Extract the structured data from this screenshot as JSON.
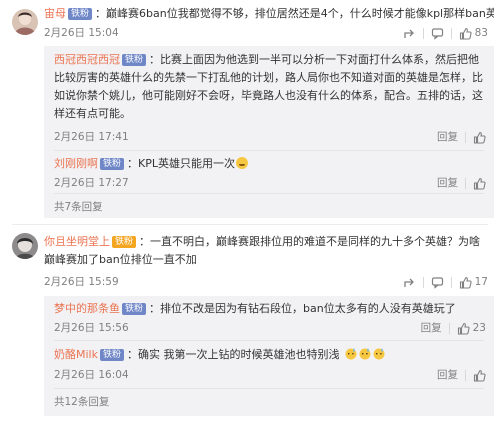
{
  "comments": [
    {
      "user": "宙母",
      "badge": "铁粉",
      "text": "巅峰赛6ban位我都觉得不够，排位居然还是4个，什么时候才能像kpl那样ban英雄",
      "time": "2月26日 15:04",
      "reply_label": "回复",
      "likes": "83",
      "replies": [
        {
          "user": "西冠西冠西冠",
          "badge": "铁粉",
          "text": "比赛上面因为他选到一半可以分析一下对面打什么体系，然后把他比较厉害的英雄什么的先禁一下打乱他的计划，路人局你也不知道对面的英雄是怎样，比如说你禁个姚儿，他可能刚好不会呀，毕竟路人也没有什么的体系，配合。五排的话，这样还有点可能。",
          "time": "2月26日 17:41",
          "reply_label": "回复",
          "likes": ""
        },
        {
          "user": "刘刚刚啊",
          "badge": "铁粉",
          "text": "KPL英雄只能用一次",
          "time": "2月26日 17:27",
          "reply_label": "回复",
          "likes": ""
        }
      ],
      "more": "共7条回复"
    },
    {
      "user": "你且坐明堂上",
      "badge": "铁粉",
      "text": "一直不明白，巅峰赛跟排位用的难道不是同样的九十多个英雄？为啥巅峰赛加了ban位排位一直不加",
      "time": "2月26日 15:59",
      "reply_label": "回复",
      "likes": "17",
      "replies": [
        {
          "user": "梦中的那条鱼",
          "badge": "铁粉",
          "text": "排位不改是因为有钻石段位，ban位太多有的人没有英雄玩了",
          "time": "2月26日 15:56",
          "reply_label": "回复",
          "likes": "23"
        },
        {
          "user": "奶酪Milk",
          "badge": "铁粉",
          "text": "确实 我第一次上钻的时候英雄池也特别浅",
          "time": "2月26日 16:04",
          "reply_label": "回复",
          "likes": ""
        }
      ],
      "more": "共12条回复"
    }
  ],
  "colors": {
    "username": "#eb7350",
    "badge": "#6f86c7",
    "meta": "#808080",
    "reply_bg": "#f2f2f5"
  },
  "icons": [
    "share-icon",
    "comment-icon",
    "like-icon",
    "emoji-laugh",
    "emoji-sweat"
  ]
}
